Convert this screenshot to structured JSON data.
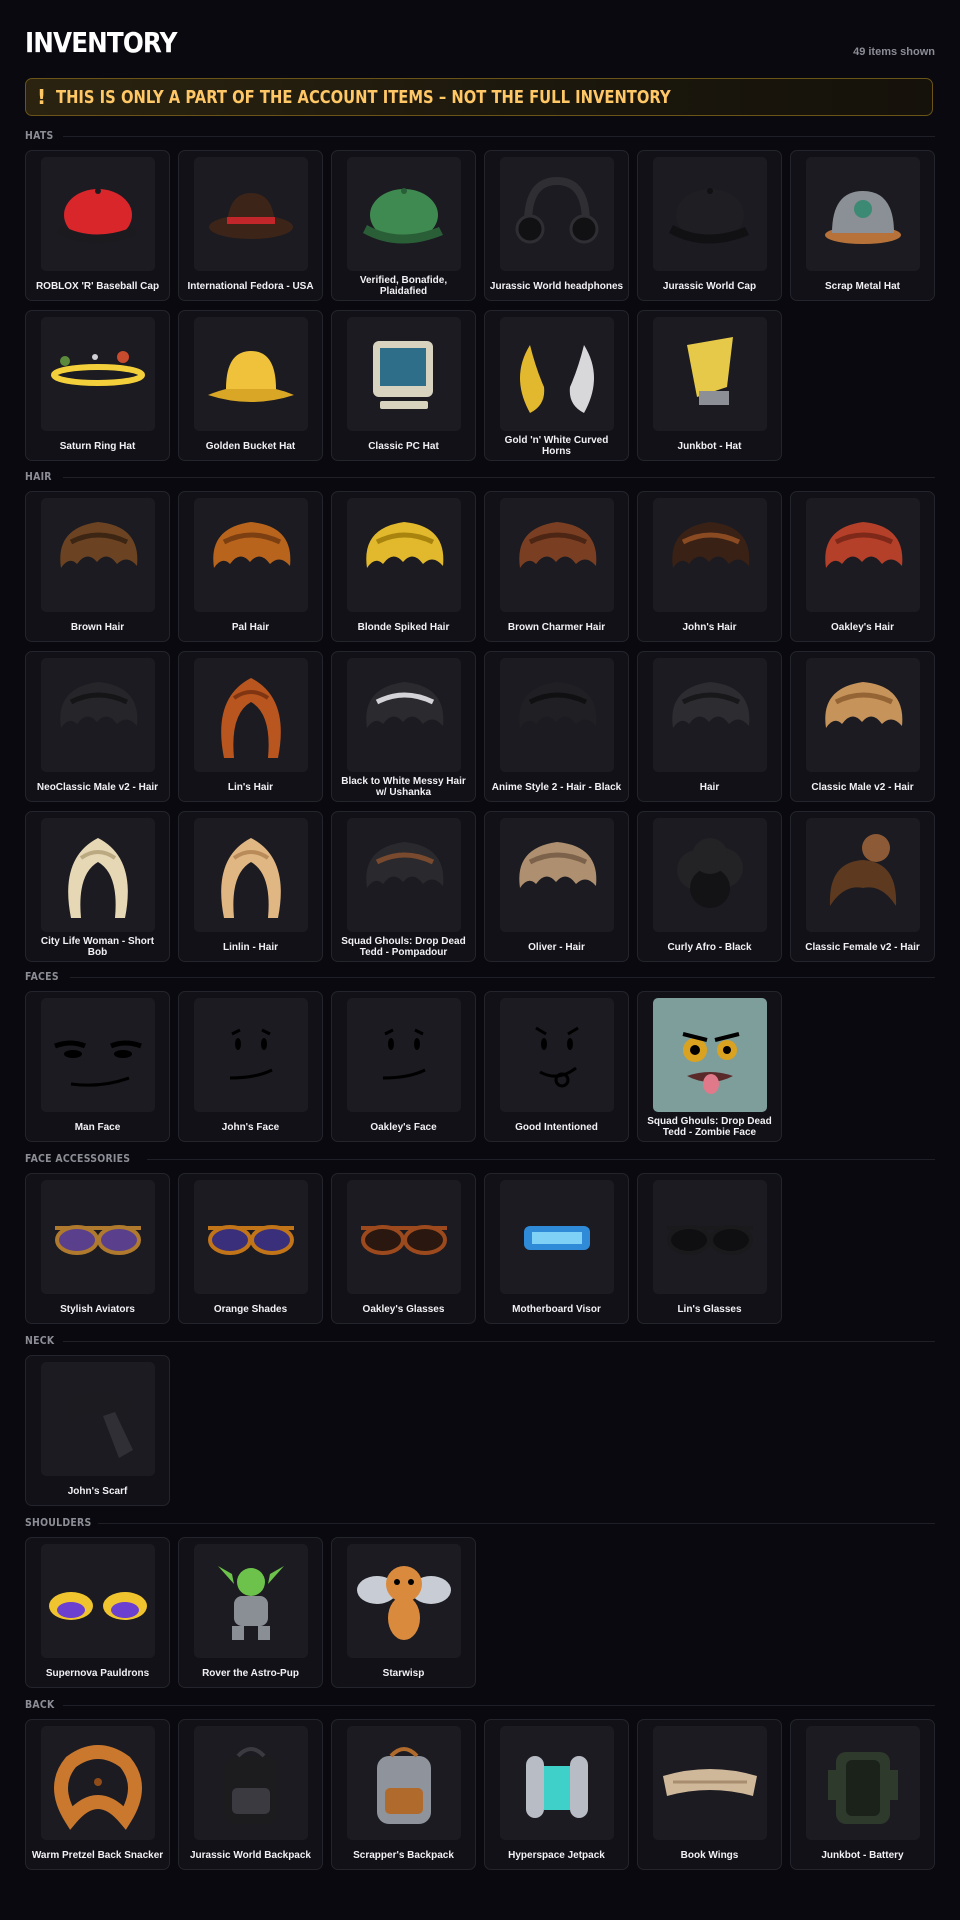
{
  "header": {
    "title": "INVENTORY",
    "count": "49 items shown"
  },
  "banner": {
    "icon": "!",
    "text": "THIS IS ONLY A PART OF THE ACCOUNT ITEMS – NOT THE FULL INVENTORY"
  },
  "sections": [
    {
      "label": "HATS",
      "items": [
        {
          "name": "ROBLOX 'R' Baseball Cap",
          "icon": "cap-icon",
          "colors": [
            "#d8262b",
            "#1b1b1f"
          ]
        },
        {
          "name": "International Fedora - USA",
          "icon": "fedora-icon",
          "colors": [
            "#3c2418",
            "#c0262a"
          ]
        },
        {
          "name": "Verified, Bonafide, Plaidafied",
          "icon": "cap-icon",
          "colors": [
            "#3f8a51",
            "#2a5e37"
          ]
        },
        {
          "name": "Jurassic World headphones",
          "icon": "headphones-icon",
          "colors": [
            "#2e2e33",
            "#111114"
          ]
        },
        {
          "name": "Jurassic World Cap",
          "icon": "cap-icon",
          "colors": [
            "#1f1f23",
            "#111114"
          ]
        },
        {
          "name": "Scrap Metal Hat",
          "icon": "helmet-icon",
          "colors": [
            "#8b8f96",
            "#b7723a"
          ]
        },
        {
          "name": "Saturn Ring Hat",
          "icon": "ring-icon",
          "colors": [
            "#f2cf3b",
            "#c84b2d"
          ]
        },
        {
          "name": "Golden Bucket Hat",
          "icon": "bucket-hat-icon",
          "colors": [
            "#d9a626",
            "#f0c13b"
          ]
        },
        {
          "name": "Classic PC Hat",
          "icon": "computer-icon",
          "colors": [
            "#d8d3bf",
            "#2f6e88"
          ]
        },
        {
          "name": "Gold 'n' White Curved Horns",
          "icon": "horns-icon",
          "colors": [
            "#e2b92e",
            "#d8d8da"
          ]
        },
        {
          "name": "Junkbot - Hat",
          "icon": "junk-hat-icon",
          "colors": [
            "#e6c949",
            "#8d8f96"
          ]
        }
      ]
    },
    {
      "label": "HAIR",
      "items": [
        {
          "name": "Brown Hair",
          "icon": "hair-icon",
          "colors": [
            "#6b4322",
            "#3d2513"
          ]
        },
        {
          "name": "Pal Hair",
          "icon": "hair-icon",
          "colors": [
            "#b8641d",
            "#7b3f12"
          ]
        },
        {
          "name": "Blonde Spiked Hair",
          "icon": "hair-icon",
          "colors": [
            "#e2b92c",
            "#a8840f"
          ]
        },
        {
          "name": "Brown Charmer Hair",
          "icon": "hair-icon",
          "colors": [
            "#7a3f22",
            "#4d2514"
          ]
        },
        {
          "name": "John's Hair",
          "icon": "hair-icon",
          "colors": [
            "#3a2115",
            "#8a4a22"
          ]
        },
        {
          "name": "Oakley's Hair",
          "icon": "hair-icon",
          "colors": [
            "#b4402a",
            "#7d2818"
          ]
        },
        {
          "name": "NeoClassic Male v2 - Hair",
          "icon": "hair-icon",
          "colors": [
            "#26262a",
            "#151517"
          ]
        },
        {
          "name": "Lin's Hair",
          "icon": "long-hair-icon",
          "colors": [
            "#b9561f",
            "#7f3511"
          ]
        },
        {
          "name": "Black to White Messy Hair w/ Ushanka",
          "icon": "hair-icon",
          "colors": [
            "#2b2b2f",
            "#d4d4d8"
          ]
        },
        {
          "name": "Anime Style 2 - Hair - Black",
          "icon": "hair-icon",
          "colors": [
            "#202024",
            "#101012"
          ]
        },
        {
          "name": "Hair",
          "icon": "hair-icon",
          "colors": [
            "#2c2c31",
            "#18181b"
          ]
        },
        {
          "name": "Classic Male v2 - Hair",
          "icon": "hair-icon",
          "colors": [
            "#c6935b",
            "#946434"
          ]
        },
        {
          "name": "City Life Woman - Short Bob",
          "icon": "long-hair-icon",
          "colors": [
            "#e6d7b5",
            "#bba982"
          ]
        },
        {
          "name": "Linlin - Hair",
          "icon": "long-hair-icon",
          "colors": [
            "#e0b683",
            "#b88b58"
          ]
        },
        {
          "name": "Squad Ghouls: Drop Dead Tedd - Pompadour",
          "icon": "hair-icon",
          "colors": [
            "#2a2a2e",
            "#7a4a2e"
          ]
        },
        {
          "name": "Oliver - Hair",
          "icon": "hair-icon",
          "colors": [
            "#ae9070",
            "#7c624a"
          ]
        },
        {
          "name": "Curly Afro - Black",
          "icon": "afro-icon",
          "colors": [
            "#232326",
            "#131315"
          ]
        },
        {
          "name": "Classic Female v2 - Hair",
          "icon": "bun-hair-icon",
          "colors": [
            "#8c5a36",
            "#5d391f"
          ]
        }
      ]
    },
    {
      "label": "FACES",
      "items": [
        {
          "name": "Man Face",
          "icon": "man-face-icon",
          "colors": [
            "#0c0c0f",
            "#1b1b21"
          ]
        },
        {
          "name": "John's Face",
          "icon": "smile-face-icon",
          "colors": [
            "#0c0c0f",
            "#1b1b21"
          ]
        },
        {
          "name": "Oakley's Face",
          "icon": "smile-face-icon",
          "colors": [
            "#0c0c0f",
            "#1b1b21"
          ]
        },
        {
          "name": "Good Intentioned",
          "icon": "tongue-face-icon",
          "colors": [
            "#0c0c0f",
            "#1b1b21"
          ]
        },
        {
          "name": "Squad Ghouls: Drop Dead Tedd - Zombie Face",
          "icon": "zombie-face-icon",
          "colors": [
            "#7e9e9c",
            "#d9a321"
          ]
        }
      ]
    },
    {
      "label": "FACE ACCESSORIES",
      "items": [
        {
          "name": "Stylish Aviators",
          "icon": "glasses-icon",
          "colors": [
            "#b07a2e",
            "#5a3f8c"
          ]
        },
        {
          "name": "Orange Shades",
          "icon": "glasses-icon",
          "colors": [
            "#c27418",
            "#3a2f7a"
          ]
        },
        {
          "name": "Oakley's Glasses",
          "icon": "glasses-icon",
          "colors": [
            "#9c4a1d",
            "#2a1810"
          ]
        },
        {
          "name": "Motherboard Visor",
          "icon": "visor-icon",
          "colors": [
            "#2f8ad8",
            "#7fd2f5"
          ]
        },
        {
          "name": "Lin's Glasses",
          "icon": "glasses-icon",
          "colors": [
            "#1a1a1d",
            "#0f0f11"
          ]
        }
      ]
    },
    {
      "label": "NECK",
      "items": [
        {
          "name": "John's Scarf",
          "icon": "scarf-icon",
          "colors": [
            "#1c1c20",
            "#2f2f35"
          ]
        }
      ]
    },
    {
      "label": "SHOULDERS",
      "items": [
        {
          "name": "Supernova Pauldrons",
          "icon": "pauldrons-icon",
          "colors": [
            "#f0c42e",
            "#6b3fcf"
          ]
        },
        {
          "name": "Rover the Astro-Pup",
          "icon": "pet-icon",
          "colors": [
            "#8a8f96",
            "#6cc24a"
          ]
        },
        {
          "name": "Starwisp",
          "icon": "bee-icon",
          "colors": [
            "#d98a3c",
            "#c8ccd4"
          ]
        }
      ]
    },
    {
      "label": "BACK",
      "items": [
        {
          "name": "Warm Pretzel Back Snacker",
          "icon": "pretzel-icon",
          "colors": [
            "#c9782e",
            "#8f4c18"
          ]
        },
        {
          "name": "Jurassic World Backpack",
          "icon": "backpack-icon",
          "colors": [
            "#1c1c1f",
            "#3a3a40"
          ]
        },
        {
          "name": "Scrapper's Backpack",
          "icon": "backpack-icon",
          "colors": [
            "#8f949c",
            "#b06a2c"
          ]
        },
        {
          "name": "Hyperspace Jetpack",
          "icon": "jetpack-icon",
          "colors": [
            "#b8bcc4",
            "#3fd1c9"
          ]
        },
        {
          "name": "Book Wings",
          "icon": "wings-icon",
          "colors": [
            "#cfb89a",
            "#a88d6e"
          ]
        },
        {
          "name": "Junkbot - Battery",
          "icon": "battery-icon",
          "colors": [
            "#2e3b2c",
            "#1a2219"
          ]
        }
      ]
    }
  ]
}
